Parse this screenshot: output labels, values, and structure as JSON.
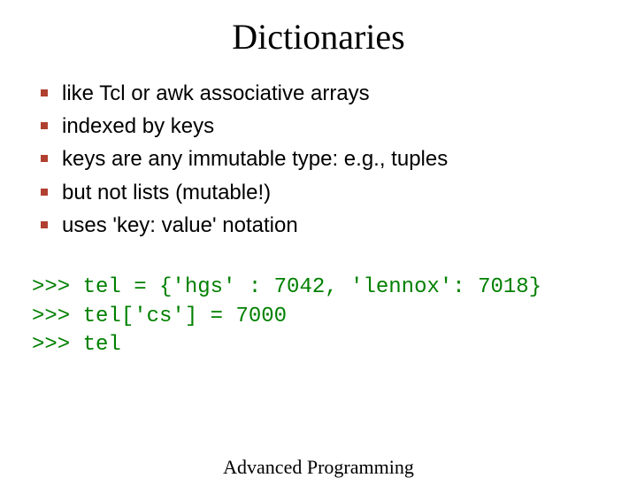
{
  "title": "Dictionaries",
  "bullets": [
    "like Tcl or awk associative arrays",
    "indexed by keys",
    "keys are any immutable type: e.g., tuples",
    "but not lists (mutable!)",
    "uses 'key: value' notation"
  ],
  "code_lines": [
    ">>> tel = {'hgs' : 7042, 'lennox': 7018}",
    ">>> tel['cs'] = 7000",
    ">>> tel"
  ],
  "footer": "Advanced\nProgramming"
}
